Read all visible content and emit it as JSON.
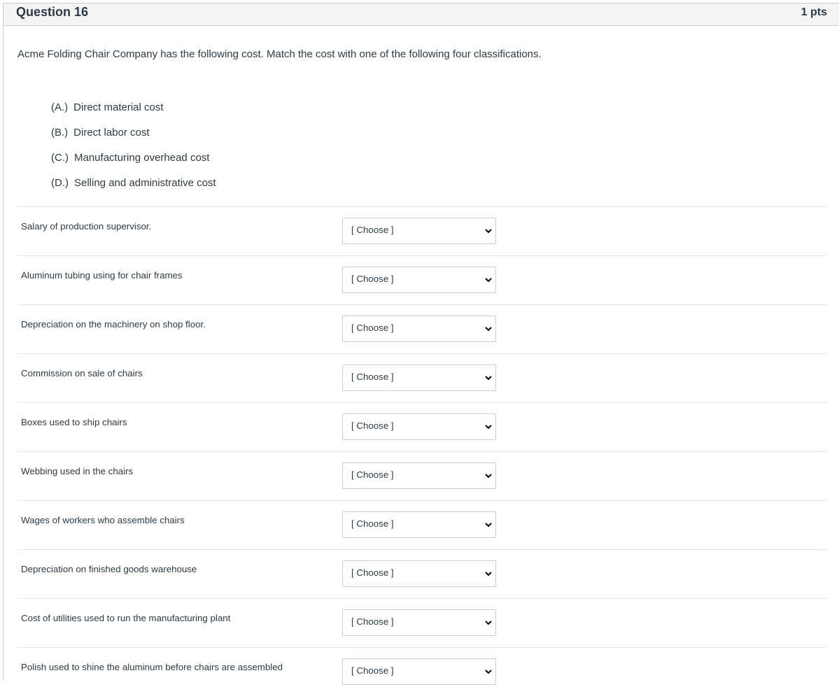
{
  "question": {
    "title": "Question 16",
    "points": "1 pts",
    "text": "Acme Folding Chair Company has the following cost. Match the cost with one of the following four classifications."
  },
  "options": [
    {
      "letter": "(A.)",
      "label": "Direct material cost"
    },
    {
      "letter": "(B.)",
      "label": "Direct labor cost"
    },
    {
      "letter": "(C.)",
      "label": "Manufacturing overhead cost"
    },
    {
      "letter": "(D.)",
      "label": "Selling and administrative cost"
    }
  ],
  "matches": [
    {
      "label": "Salary of production supervisor.",
      "selected": "[ Choose ]"
    },
    {
      "label": "Aluminum tubing using for chair frames",
      "selected": "[ Choose ]"
    },
    {
      "label": "Depreciation on the machinery on shop floor.",
      "selected": "[ Choose ]"
    },
    {
      "label": "Commission on sale of chairs",
      "selected": "[ Choose ]"
    },
    {
      "label": "Boxes used to ship chairs",
      "selected": "[ Choose ]"
    },
    {
      "label": "Webbing used in the chairs",
      "selected": "[ Choose ]"
    },
    {
      "label": "Wages of workers who assemble chairs",
      "selected": "[ Choose ]"
    },
    {
      "label": "Depreciation on finished goods warehouse",
      "selected": "[ Choose ]"
    },
    {
      "label": "Cost of utilities used to run the manufacturing plant",
      "selected": "[ Choose ]"
    },
    {
      "label": "Polish used to shine the aluminum before chairs are assembled",
      "selected": "[ Choose ]"
    }
  ],
  "icons": {
    "dropdown": "chevron-down-icon"
  },
  "colors": {
    "text": "#2d3b45",
    "header_bg": "#f5f5f5",
    "border": "#c7cdd1"
  }
}
